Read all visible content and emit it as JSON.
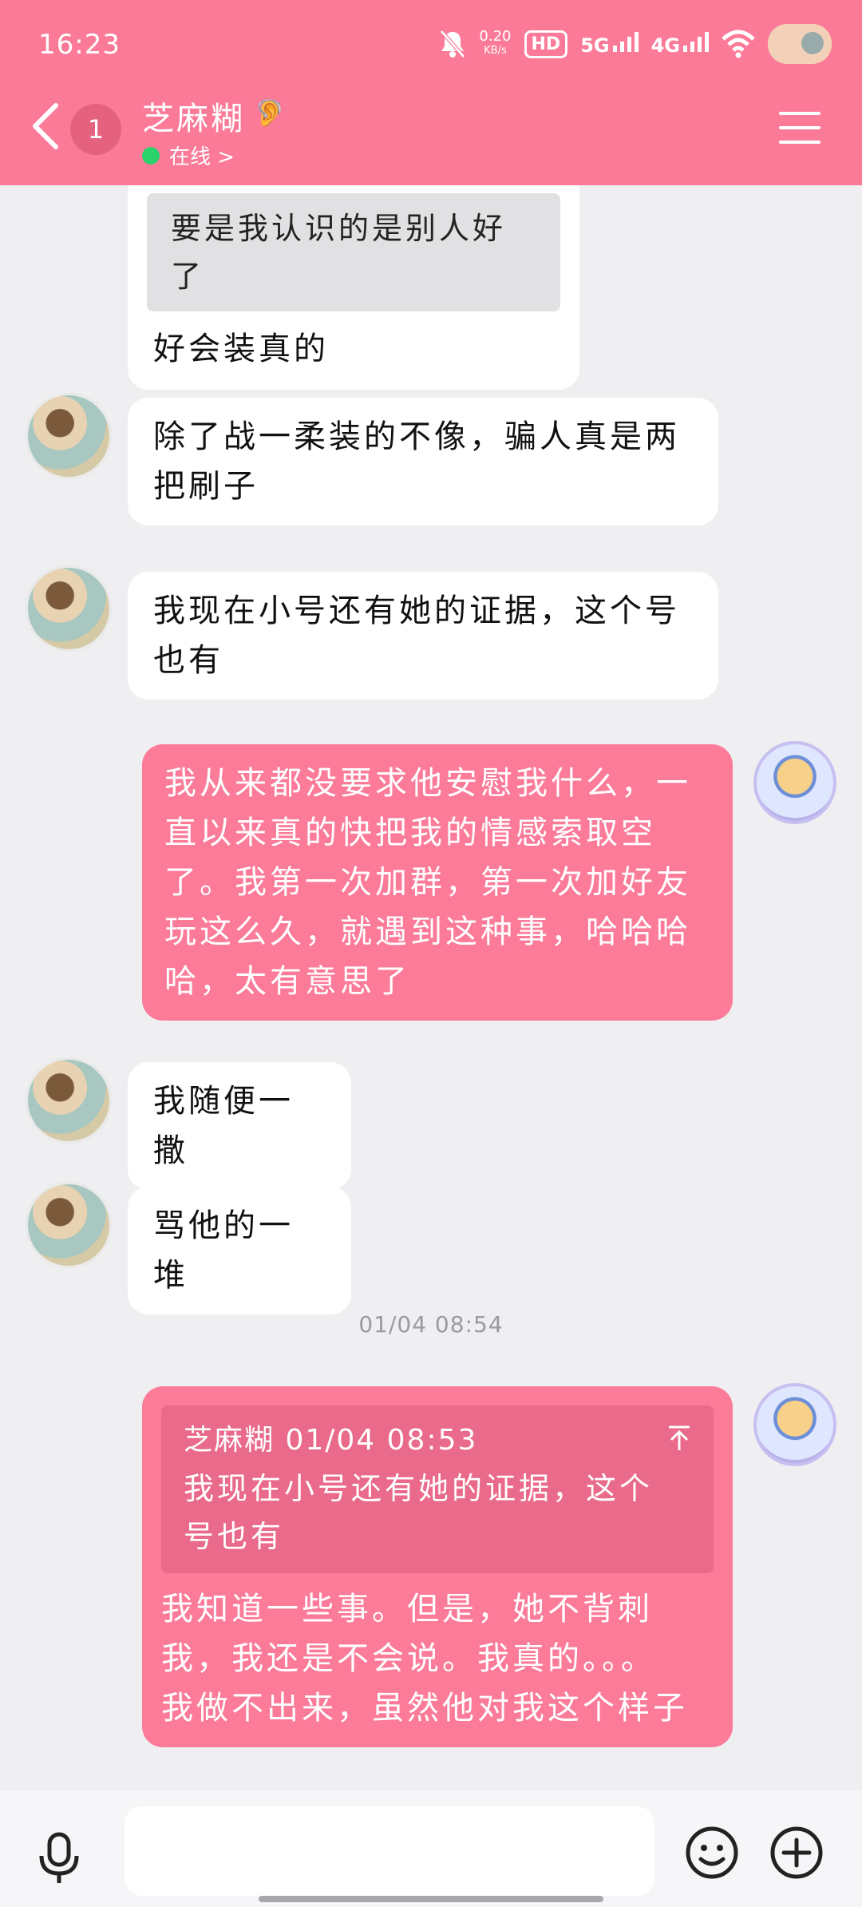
{
  "status_bar": {
    "time": "16:23",
    "net_speed_top": "0.20",
    "net_speed_bottom": "KB/s",
    "hd_label": "HD",
    "net_5g": "5G",
    "net_4g": "4G"
  },
  "header": {
    "unread_count": "1",
    "contact_name": "芝麻糊",
    "status_text": "在线 >"
  },
  "messages": [
    {
      "quote": "要是我认识的是别人好了",
      "text": "好会装真的"
    },
    {
      "text_line1": "除了战一柔装的不像，骗人真是两",
      "text_line2": "把刷子"
    },
    {
      "text_line1": "我现在小号还有她的证据，这个号",
      "text_line2": "也有"
    },
    {
      "lines": [
        "我从来都没要求他安慰我什么，一",
        "直以来真的快把我的情感索取空",
        "了。我第一次加群，第一次加好友",
        "玩这么久，就遇到这种事，哈哈哈",
        "哈，太有意思了"
      ]
    },
    {
      "text": "我随便一撒"
    },
    {
      "text": "骂他的一堆"
    }
  ],
  "timestamp": "01/04 08:54",
  "last_message": {
    "quote_header": "芝麻糊 01/04 08:53",
    "quote_line1": "我现在小号还有她的证据，这个",
    "quote_line2": "号也有",
    "lines": [
      "我知道一些事。但是，她不背刺",
      "我，我还是不会说。我真的。。。",
      "我做不出来，虽然他对我这个样子"
    ]
  },
  "colors": {
    "accent": "#fb7a98",
    "bubble_self": "#fb7b99",
    "quote_self": "#e96a8a",
    "online": "#2bd26b",
    "background": "#efeff2"
  },
  "icons": [
    "back-icon",
    "ear-icon",
    "menu-icon",
    "mic-icon",
    "emoji-icon",
    "plus-icon",
    "jump-to-top-icon"
  ]
}
